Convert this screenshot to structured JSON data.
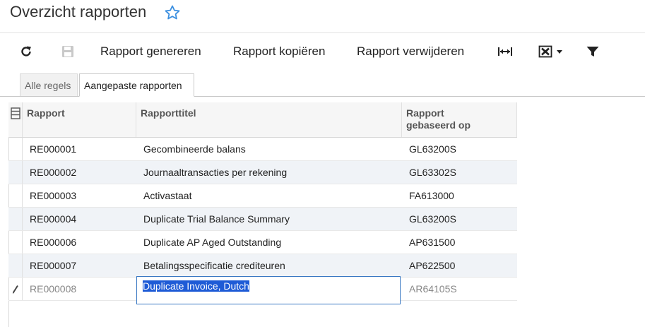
{
  "page": {
    "title": "Overzicht rapporten"
  },
  "toolbar": {
    "generate_label": "Rapport genereren",
    "copy_label": "Rapport kopiëren",
    "delete_label": "Rapport verwijderen"
  },
  "tabs": [
    {
      "label": "Alle regels",
      "active": false
    },
    {
      "label": "Aangepaste rapporten",
      "active": true
    }
  ],
  "grid": {
    "columns": [
      "Rapport",
      "Rapporttitel",
      "Rapport gebaseerd op"
    ],
    "rows": [
      {
        "report": "RE000001",
        "title": "Gecombineerde balans",
        "based_on": "GL63200S"
      },
      {
        "report": "RE000002",
        "title": "Journaaltransacties per rekening",
        "based_on": "GL63302S"
      },
      {
        "report": "RE000003",
        "title": "Activastaat",
        "based_on": "FA613000"
      },
      {
        "report": "RE000004",
        "title": "Duplicate Trial Balance Summary",
        "based_on": "GL63200S"
      },
      {
        "report": "RE000006",
        "title": "Duplicate AP Aged Outstanding",
        "based_on": "AP631500"
      },
      {
        "report": "RE000007",
        "title": "Betalingsspecificatie crediteuren",
        "based_on": "AP622500"
      },
      {
        "report": "RE000008",
        "title": "Duplicate Invoice, Dutch",
        "based_on": "AR64105S",
        "editing": true
      }
    ]
  },
  "colors": {
    "accent": "#1e5bd6",
    "star": "#3b8fe0"
  }
}
